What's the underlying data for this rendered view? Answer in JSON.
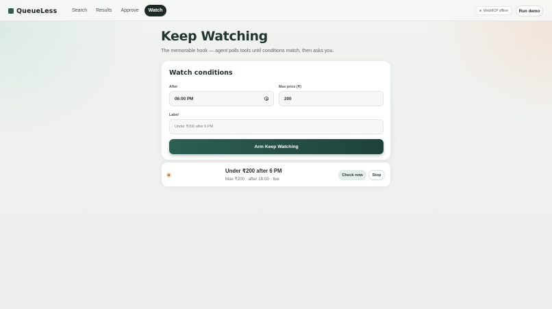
{
  "app": {
    "brand_name": "QueueLess",
    "brand_icon": "square-logo-icon"
  },
  "nav": {
    "items": [
      {
        "label": "Search",
        "active": false
      },
      {
        "label": "Results",
        "active": false
      },
      {
        "label": "Approve",
        "active": false
      },
      {
        "label": "Watch",
        "active": true
      }
    ]
  },
  "header": {
    "status": "WebMCP offline",
    "run_demo_label": "Run demo"
  },
  "page": {
    "title": "Keep Watching",
    "subtitle": "The memorable hook — agent polls tools until conditions match, then asks you."
  },
  "conditions": {
    "title": "Watch conditions",
    "after_label": "After",
    "after_value": "06:00 PM",
    "max_price_label": "Max price (₹)",
    "max_price_value": "200",
    "label_label": "Label",
    "label_placeholder": "Under ₹200 after 6 PM",
    "submit_label": "Arm Keep Watching"
  },
  "watch": {
    "title": "Under ₹200 after 6 PM",
    "meta": "Max ₹200 · after 18:00 · live",
    "check_now_label": "Check now",
    "stop_label": "Stop"
  },
  "colors": {
    "accent": "#2c5f54",
    "nav_active": "#1d2a27",
    "live_indicator": "#c96a2a"
  }
}
